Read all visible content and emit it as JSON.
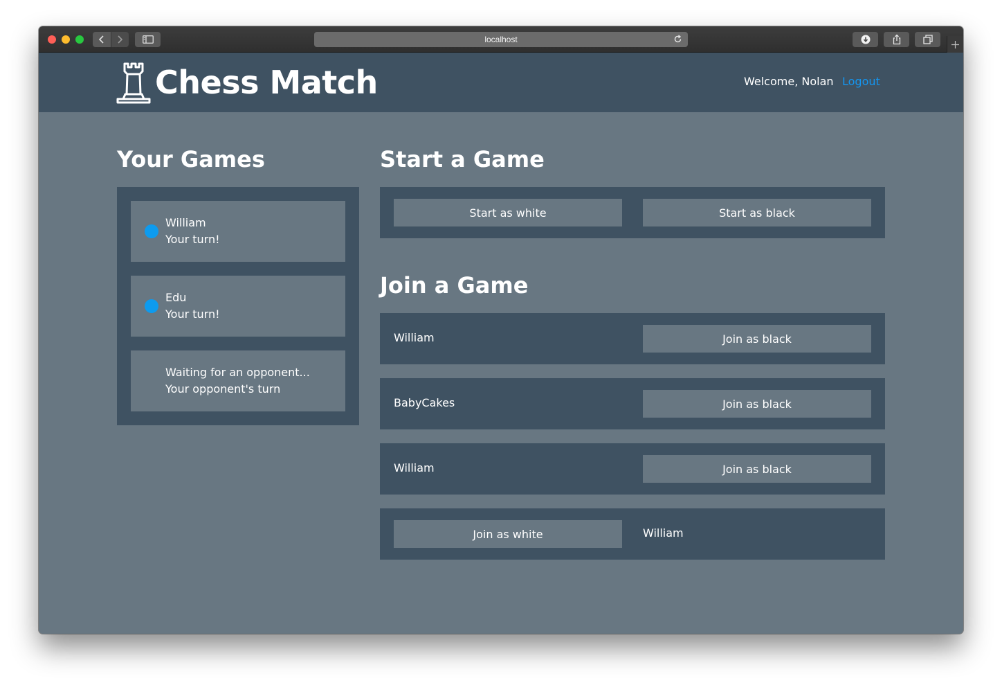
{
  "browser": {
    "url": "localhost"
  },
  "header": {
    "title": "Chess Match",
    "welcome": "Welcome, Nolan",
    "logout": "Logout"
  },
  "your_games": {
    "heading": "Your Games",
    "games": [
      {
        "opponent": "William",
        "status": "Your turn!",
        "my_turn": true
      },
      {
        "opponent": "Edu",
        "status": "Your turn!",
        "my_turn": true
      },
      {
        "opponent": "Waiting for an opponent...",
        "status": "Your opponent's turn",
        "my_turn": false
      }
    ]
  },
  "start_game": {
    "heading": "Start a Game",
    "white_label": "Start as white",
    "black_label": "Start as black"
  },
  "join_game": {
    "heading": "Join a Game",
    "games": [
      {
        "player": "William",
        "button": "Join as black"
      },
      {
        "player": "BabyCakes",
        "button": "Join as black"
      },
      {
        "player": "William",
        "button": "Join as black"
      },
      {
        "player": "William",
        "button": "Join as white"
      }
    ]
  },
  "colors": {
    "header_bg": "#3f5262",
    "page_bg": "#687782",
    "accent": "#1496f0",
    "turn_dot": "#0d9bef"
  }
}
